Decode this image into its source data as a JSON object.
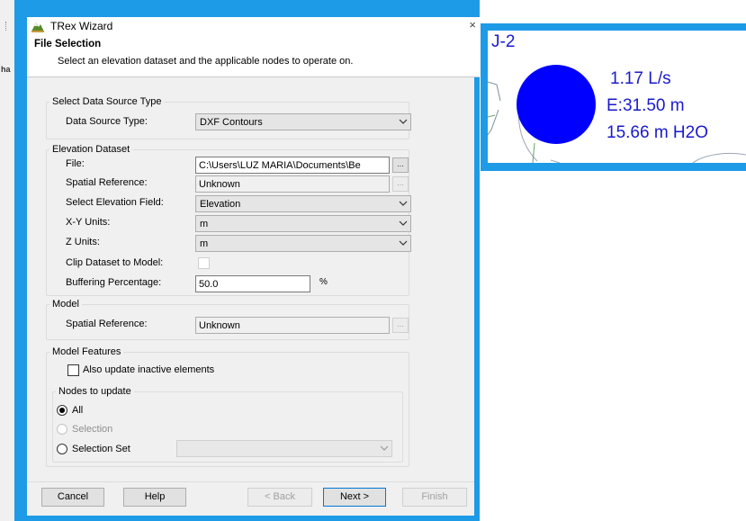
{
  "window": {
    "title": "TRex Wizard",
    "close_glyph": "×"
  },
  "background_app": {
    "fragment": "ha"
  },
  "header": {
    "title": "File Selection",
    "subtitle": "Select an elevation dataset and the applicable nodes to operate on."
  },
  "data_source": {
    "group_title": "Select Data Source Type",
    "label": "Data Source Type:",
    "value": "DXF Contours"
  },
  "elevation": {
    "group_title": "Elevation Dataset",
    "file_label": "File:",
    "file_value": "C:\\Users\\LUZ MARIA\\Documents\\Be",
    "browse_glyph": "...",
    "spatial_label": "Spatial Reference:",
    "spatial_value": "Unknown",
    "field_label": "Select Elevation Field:",
    "field_value": "Elevation",
    "xy_label": "X-Y Units:",
    "xy_value": "m",
    "z_label": "Z Units:",
    "z_value": "m",
    "clip_label": "Clip Dataset to Model:",
    "clip_checked": false,
    "buffer_label": "Buffering Percentage:",
    "buffer_value": "50.0",
    "buffer_unit": "%"
  },
  "model": {
    "group_title": "Model",
    "spatial_label": "Spatial Reference:",
    "spatial_value": "Unknown"
  },
  "features": {
    "group_title": "Model Features",
    "inactive_label": "Also update inactive elements",
    "inactive_checked": false,
    "nodes_group_title": "Nodes to update",
    "radio_all": "All",
    "radio_selection": "Selection",
    "radio_selection_set": "Selection Set",
    "selected": "All"
  },
  "buttons": {
    "cancel": "Cancel",
    "help": "Help",
    "back": "< Back",
    "next": "Next >",
    "finish": "Finish"
  },
  "annotation": {
    "node_id": "J-2",
    "demand": "1.17 L/s",
    "elevation": "E:31.50 m",
    "pressure": "15.66 m H2O",
    "node_color": "#0000ff",
    "text_color": "#1a1acc"
  },
  "colors": {
    "frame_accent": "#1e9be6",
    "default_button_border": "#0078d7"
  }
}
